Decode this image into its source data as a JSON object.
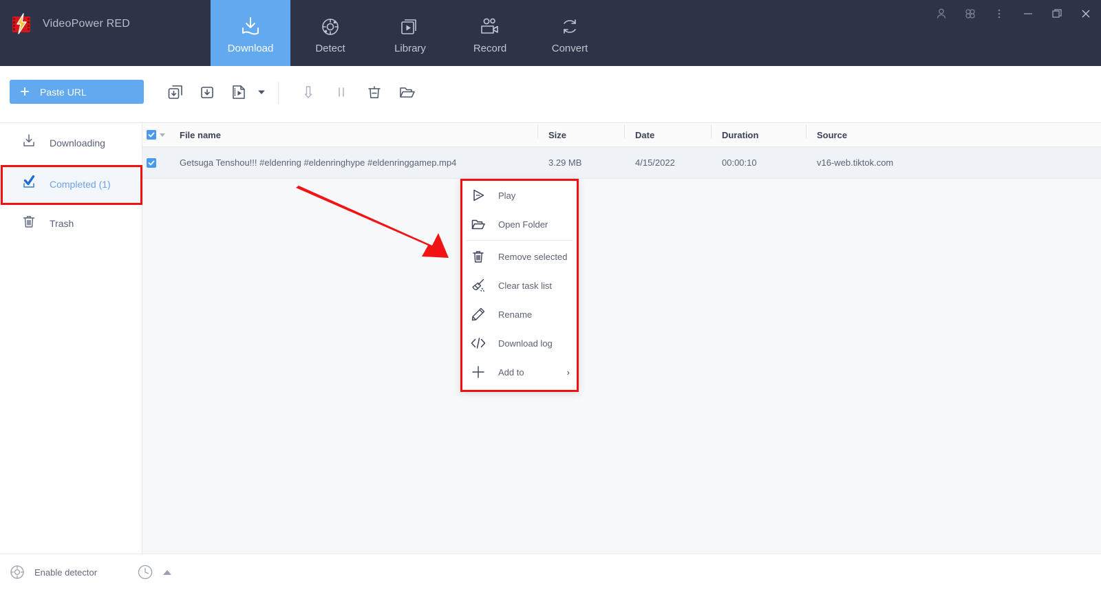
{
  "app": {
    "title": "VideoPower RED",
    "logo_icon": "videopower-logo-icon",
    "accent_color": "#62a9ef",
    "titlebar_color": "#2e3347",
    "annotation_color": "#f40f0f"
  },
  "nav": {
    "tabs": [
      {
        "label": "Download",
        "icon": "download-tray-icon",
        "active": true
      },
      {
        "label": "Detect",
        "icon": "detect-radar-icon",
        "active": false
      },
      {
        "label": "Library",
        "icon": "library-play-icon",
        "active": false
      },
      {
        "label": "Record",
        "icon": "record-camera-icon",
        "active": false
      },
      {
        "label": "Convert",
        "icon": "convert-refresh-icon",
        "active": false
      }
    ]
  },
  "window_controls": [
    {
      "name": "account-icon"
    },
    {
      "name": "apps-grid-icon"
    },
    {
      "name": "more-options-icon"
    },
    {
      "name": "minimize-icon"
    },
    {
      "name": "maximize-restore-icon"
    },
    {
      "name": "close-icon"
    }
  ],
  "toolbar": {
    "paste_url_label": "Paste URL",
    "plus_glyph": "+",
    "buttons": [
      {
        "name": "batch-download-icon"
      },
      {
        "name": "single-download-icon"
      },
      {
        "name": "video-file-download-icon"
      },
      {
        "name": "dropdown-caret-icon"
      },
      {
        "name": "resume-download-icon"
      },
      {
        "name": "pause-download-icon"
      },
      {
        "name": "delete-task-icon"
      },
      {
        "name": "open-folder-icon"
      }
    ]
  },
  "sidebar": {
    "items": [
      {
        "label": "Downloading",
        "icon": "downloading-icon",
        "active": false
      },
      {
        "label": "Completed (1)",
        "icon": "completed-check-icon",
        "active": true
      },
      {
        "label": "Trash",
        "icon": "trash-icon",
        "active": false
      }
    ]
  },
  "table": {
    "columns": [
      "File name",
      "Size",
      "Date",
      "Duration",
      "Source"
    ],
    "select_all_checked": true,
    "rows": [
      {
        "checked": true,
        "file_name": "Getsuga Tenshou!!! #eldenring #eldenringhype #eldenringgamep.mp4",
        "size": "3.29 MB",
        "date": "4/15/2022",
        "duration": "00:00:10",
        "source": "v16-web.tiktok.com"
      }
    ]
  },
  "context_menu": {
    "items": [
      {
        "label": "Play",
        "icon": "play-icon",
        "submenu": false
      },
      {
        "label": "Open Folder",
        "icon": "folder-open-icon",
        "submenu": false
      },
      {
        "label": "Remove selected",
        "icon": "trash-icon",
        "submenu": false
      },
      {
        "label": "Clear task list",
        "icon": "broom-icon",
        "submenu": false
      },
      {
        "label": "Rename",
        "icon": "pencil-icon",
        "submenu": false
      },
      {
        "label": "Download log",
        "icon": "code-brackets-icon",
        "submenu": false
      },
      {
        "label": "Add to",
        "icon": "plus-icon",
        "submenu": true,
        "submenu_glyph": "›"
      }
    ]
  },
  "statusbar": {
    "enable_detector_label": "Enable detector",
    "detector_icon": "detector-target-icon",
    "scheduler_icon": "clock-scheduler-icon",
    "expand_icon": "chevron-up-icon"
  }
}
